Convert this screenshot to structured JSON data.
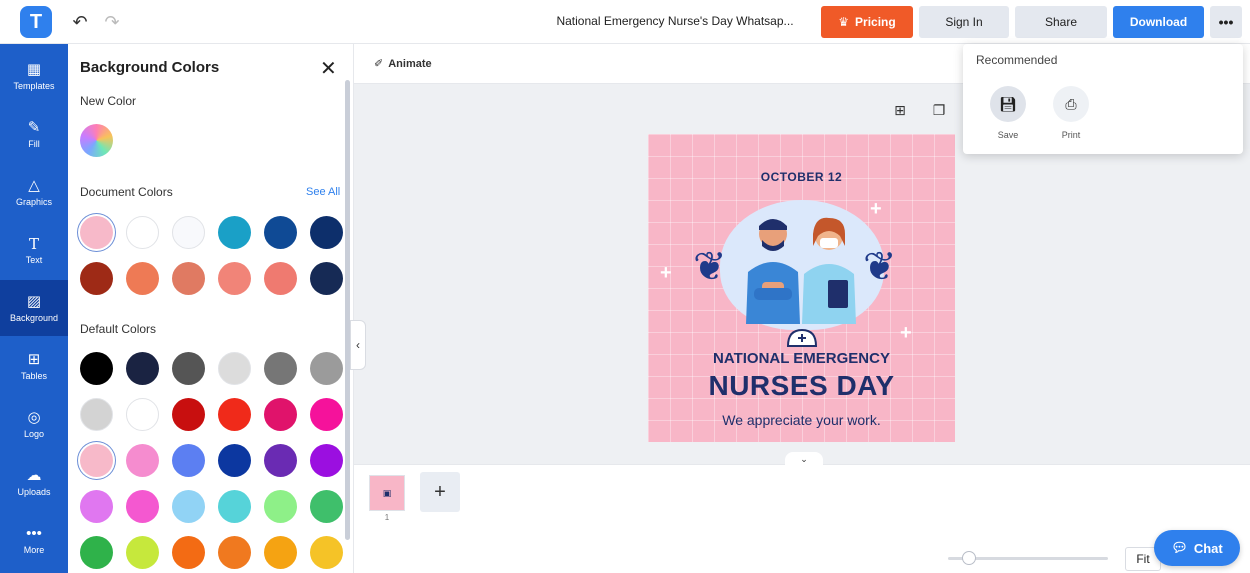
{
  "header": {
    "logo": "T",
    "doc_title": "National Emergency Nurse's Day Whatsap...",
    "pricing": "Pricing",
    "sign_in": "Sign In",
    "share": "Share",
    "download": "Download",
    "more": "•••"
  },
  "rail": {
    "items": [
      {
        "label": "Templates"
      },
      {
        "label": "Fill"
      },
      {
        "label": "Graphics"
      },
      {
        "label": "Text"
      },
      {
        "label": "Background"
      },
      {
        "label": "Tables"
      },
      {
        "label": "Logo"
      },
      {
        "label": "Uploads"
      },
      {
        "label": "More"
      }
    ]
  },
  "panel": {
    "title": "Background Colors",
    "new_color": "New Color",
    "document_colors": "Document Colors",
    "see_all": "See All",
    "default_colors": "Default Colors",
    "document_swatches": [
      "#f7b9c9",
      "#ffffff",
      "#f8f9fc",
      "#1aa0c7",
      "#0f4a95",
      "#0d2f6b",
      "#9e2a16",
      "#ee7a55",
      "#e07a62",
      "#f18478",
      "#ef7a70",
      "#162a55"
    ],
    "default_swatches": [
      "#000000",
      "#1a2342",
      "#555555",
      "#dcdcdc",
      "#767676",
      "#9b9b9b",
      "#d3d3d3",
      "#ffffff",
      "#c80f0f",
      "#f02a1a",
      "#e0136b",
      "#f5129b",
      "#f7b9c9",
      "#f58ccf",
      "#5c7ff2",
      "#0c37a0",
      "#6a2bb3",
      "#9b0fe0",
      "#e077f0",
      "#f458d0",
      "#91d3f5",
      "#56d3d9",
      "#8ef088",
      "#3fbf6b",
      "#2fb24a",
      "#c6e83c",
      "#f36b14",
      "#f0791f",
      "#f5a312",
      "#f5c327"
    ]
  },
  "toolbar": {
    "animate": "Animate",
    "collapse": "‹"
  },
  "design": {
    "date": "OCTOBER 12",
    "line1": "NATIONAL EMERGENCY",
    "line2": "NURSES DAY",
    "line3": "We appreciate your work."
  },
  "dropdown": {
    "title": "Recommended",
    "save": "Save",
    "print": "Print"
  },
  "pages": {
    "toggle": "⌄",
    "page_number": "1",
    "add": "+"
  },
  "zoom": {
    "fit": "Fit"
  },
  "chat": {
    "label": "Chat"
  },
  "colors": {
    "accent": "#2f80ed",
    "rail": "#1e5fc9",
    "pricing": "#f05a28",
    "design_bg": "#f8b6c7",
    "navy": "#1f2f6b"
  }
}
